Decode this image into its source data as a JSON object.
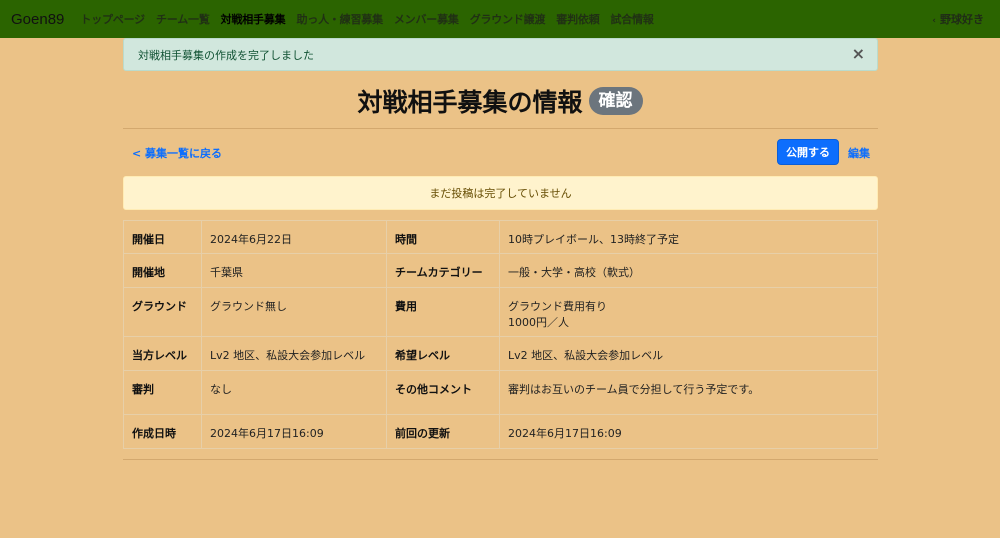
{
  "nav": {
    "brand": "Goen89",
    "links": [
      "トップページ",
      "チーム一覧",
      "対戦相手募集",
      "助っ人・練習募集",
      "メンバー募集",
      "グラウンド譲渡",
      "審判依頼",
      "試合情報"
    ],
    "active_index": 2,
    "user": "野球好き"
  },
  "flash": {
    "message": "対戦相手募集の作成を完了しました",
    "close": "×"
  },
  "title": {
    "text": "対戦相手募集の情報",
    "badge": "確認"
  },
  "actions": {
    "back": "募集一覧に戻る",
    "publish": "公開する",
    "edit": "編集"
  },
  "warning": "まだ投稿は完了していません",
  "details": [
    [
      "開催日",
      "2024年6月22日",
      "時間",
      "10時プレイボール、13時終了予定"
    ],
    [
      "開催地",
      "千葉県",
      "チームカテゴリー",
      "一般・大学・高校（軟式）"
    ],
    [
      "グラウンド",
      "グラウンド無し",
      "費用",
      "グラウンド費用有り",
      "1000円／人"
    ],
    [
      "当方レベル",
      "Lv2 地区、私設大会参加レベル",
      "希望レベル",
      "Lv2 地区、私設大会参加レベル"
    ],
    [
      "審判",
      "なし",
      "その他コメント",
      "審判はお互いのチーム員で分担して行う予定です。"
    ],
    [
      "作成日時",
      "2024年6月17日16:09",
      "前回の更新",
      "2024年6月17日16:09"
    ]
  ],
  "colors": {
    "navbar": "#2b6400",
    "background": "#ebc287",
    "primary": "#0d6efd",
    "success_bg": "#d1e7dd",
    "warning_bg": "#fff3cd",
    "badge": "#6c757d"
  }
}
